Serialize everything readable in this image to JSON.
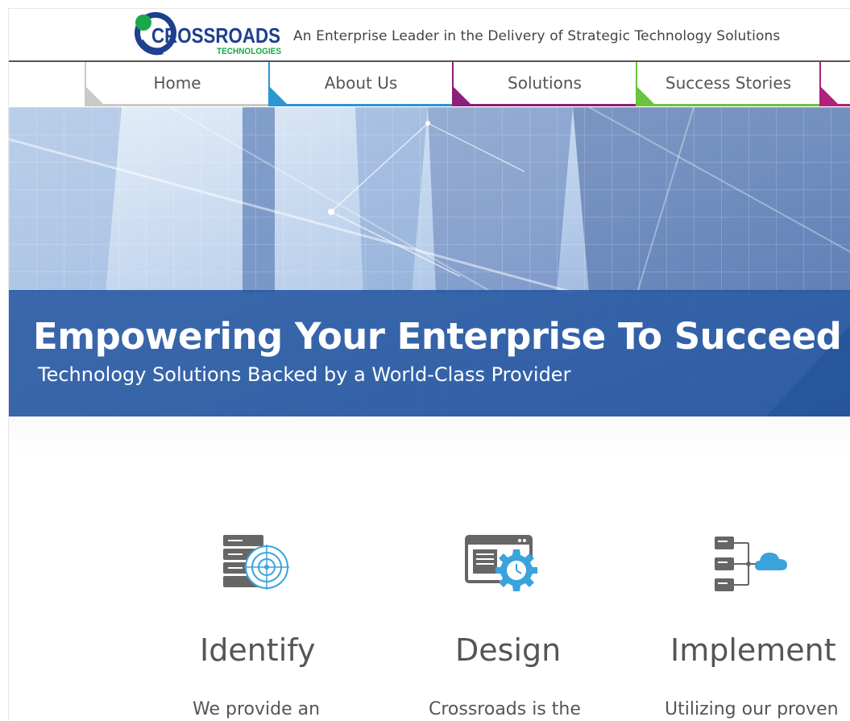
{
  "brand": {
    "name": "CROSSROADS",
    "sub": "TECHNOLOGIES",
    "tagline": "An Enterprise Leader in the Delivery of Strategic Technology Solutions",
    "colors": {
      "primary": "#1f3f8f",
      "green": "#1aa84a"
    }
  },
  "nav": {
    "items": [
      {
        "label": "Home",
        "color": "#c9c9c9"
      },
      {
        "label": "About Us",
        "color": "#2b95d6"
      },
      {
        "label": "Solutions",
        "color": "#8c1f7a"
      },
      {
        "label": "Success Stories",
        "color": "#6ac43d"
      },
      {
        "label": "",
        "color": "#b0217a"
      }
    ]
  },
  "hero": {
    "title": "Empowering Your Enterprise To Succeed",
    "subtitle": "Technology Solutions Backed by a World-Class Provider"
  },
  "features": [
    {
      "icon": "server-target-icon",
      "title": "Identify",
      "text": "We provide an"
    },
    {
      "icon": "browser-gear-icon",
      "title": "Design",
      "text": "Crossroads is the"
    },
    {
      "icon": "server-cloud-icon",
      "title": "Implement",
      "text": "Utilizing our proven"
    }
  ]
}
